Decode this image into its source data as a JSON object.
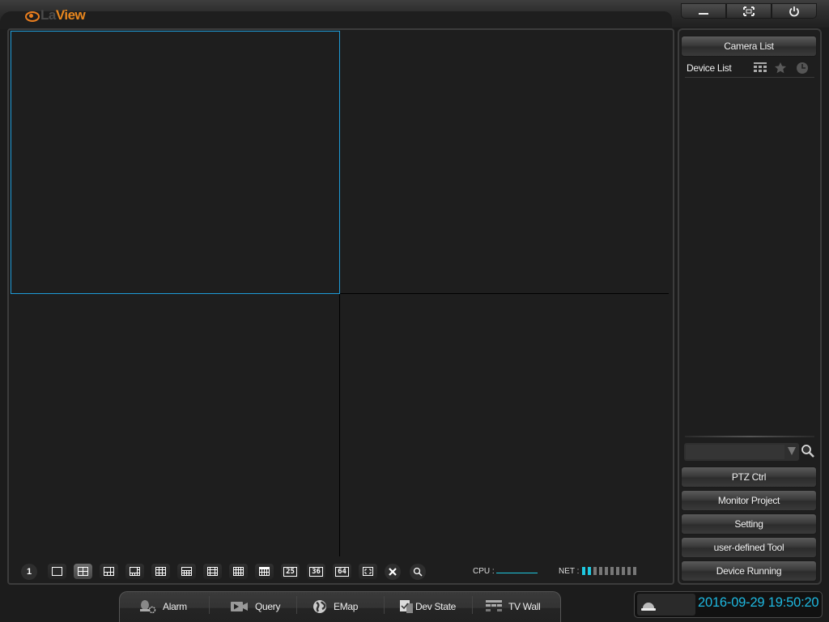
{
  "app": {
    "logo_prefix": "La",
    "logo_suffix": "View"
  },
  "window_controls": [
    {
      "name": "minimize",
      "icon": "minimize-icon"
    },
    {
      "name": "fullscreen",
      "icon": "fullscreen-icon"
    },
    {
      "name": "power",
      "icon": "power-icon"
    }
  ],
  "video": {
    "layout": "2x2",
    "selected_cell": 0,
    "cell_count": 4
  },
  "toolbar": {
    "channel_label": "1",
    "layouts": [
      "1x1",
      "2x2",
      "1+5",
      "1+7",
      "3x3",
      "1+12",
      "4x4",
      "5x5-a",
      "6x6-a",
      "25",
      "36",
      "64",
      "fit"
    ],
    "grid_25_label": "25",
    "grid_36_label": "36",
    "grid_64_label": "64",
    "active_layout": "2x2",
    "cpu_label": "CPU :",
    "net_label": "NET :",
    "net_level": 2,
    "net_bars": 10
  },
  "sidebar": {
    "camera_list_label": "Camera List",
    "device_list_label": "Device List",
    "icons": [
      "group-icon",
      "favorite-star-icon",
      "history-clock-icon"
    ],
    "search": {
      "value": "",
      "placeholder": ""
    },
    "buttons": [
      {
        "label": "PTZ Ctrl"
      },
      {
        "label": "Monitor Project"
      },
      {
        "label": "Setting"
      },
      {
        "label": "user-defined Tool"
      },
      {
        "label": "Device Running"
      }
    ]
  },
  "bottom_tabs": [
    {
      "label": "Alarm",
      "icon": "alarm-settings-icon"
    },
    {
      "label": "Query",
      "icon": "video-camera-icon"
    },
    {
      "label": "EMap",
      "icon": "globe-icon"
    },
    {
      "label": "Dev State",
      "icon": "checklist-icon"
    },
    {
      "label": "TV Wall",
      "icon": "tv-wall-icon"
    }
  ],
  "status": {
    "datetime": "2016-09-29 19:50:20",
    "accent_color": "#1eb8e0",
    "selection_color": "#1e9bd7",
    "logo_color": "#e8871e"
  }
}
